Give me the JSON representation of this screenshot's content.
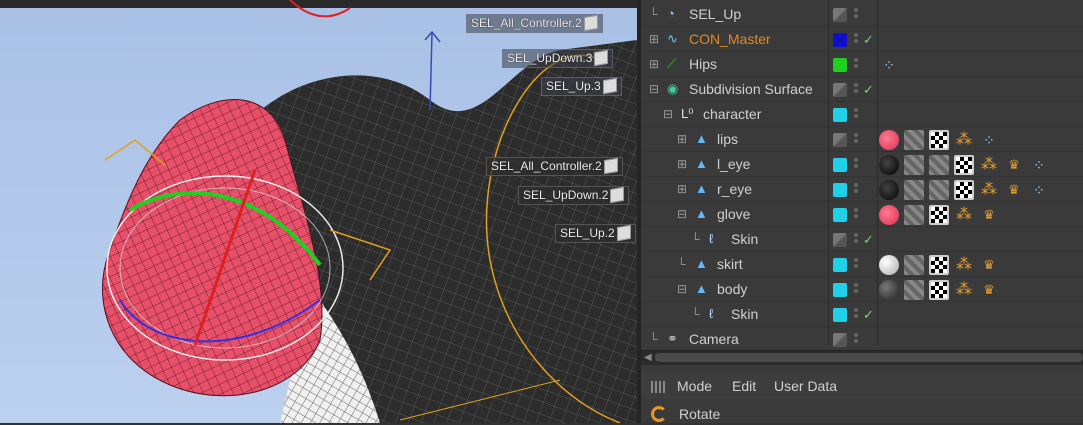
{
  "viewport": {
    "labels": [
      {
        "text": "SEL_All_Controller.2",
        "style": "light",
        "icon": "cube-icon"
      },
      {
        "text": "SEL_UpDown.3",
        "style": "light",
        "icon": "cube-icon"
      },
      {
        "text": "SEL_Up.3",
        "style": "light",
        "icon": "cube-icon"
      },
      {
        "text": "SEL_All_Controller.2",
        "style": "dark",
        "icon": "cube-icon"
      },
      {
        "text": "SEL_UpDown.2",
        "style": "dark",
        "icon": "cube-icon"
      },
      {
        "text": "SEL_Up.2",
        "style": "dark",
        "icon": "cube-icon"
      }
    ]
  },
  "object_manager": {
    "rows": [
      {
        "name": "SEL_Up",
        "icon": "selection-object-icon",
        "layer_color": "grey",
        "checked": false,
        "tags": []
      },
      {
        "name": "CON_Master",
        "icon": "spline-icon",
        "layer_color": "#1010c8",
        "checked": true,
        "name_color": "#e08a20",
        "tags": []
      },
      {
        "name": "Hips",
        "icon": "bone-icon",
        "layer_color": "#20d020",
        "checked": false,
        "tags": [
          "selection-tag-icon"
        ]
      },
      {
        "name": "Subdivision Surface",
        "icon": "subdivision-surface-icon",
        "layer_color": "grey",
        "checked": true,
        "tags": []
      },
      {
        "name": "character",
        "icon": "null-object-icon",
        "layer_color": "#20d0e8",
        "checked": false,
        "tags": []
      },
      {
        "name": "lips",
        "icon": "polygon-object-icon",
        "layer_color": "grey",
        "checked": false,
        "tags": [
          "material-red-icon",
          "texture-tag-icon",
          "checker-tag-icon",
          "uvw-tag-icon",
          "selection-tag-icon"
        ]
      },
      {
        "name": "l_eye",
        "icon": "polygon-object-icon",
        "layer_color": "#20d0e8",
        "checked": false,
        "tags": [
          "material-black-icon",
          "texture-tag-icon",
          "texture-tag-icon",
          "checker-tag-icon",
          "uvw-tag-icon",
          "weight-tag-icon",
          "selection-tag-icon"
        ]
      },
      {
        "name": "r_eye",
        "icon": "polygon-object-icon",
        "layer_color": "#20d0e8",
        "checked": false,
        "tags": [
          "material-black-icon",
          "texture-tag-icon",
          "texture-tag-icon",
          "checker-tag-icon",
          "uvw-tag-icon",
          "weight-tag-icon",
          "selection-tag-icon"
        ]
      },
      {
        "name": "glove",
        "icon": "polygon-object-icon",
        "layer_color": "#20d0e8",
        "checked": false,
        "tags": [
          "material-red-icon",
          "texture-tag-icon",
          "checker-tag-icon",
          "uvw-tag-icon",
          "weight-tag-icon"
        ]
      },
      {
        "name": "Skin",
        "icon": "skin-deformer-icon",
        "layer_color": "grey",
        "checked": true,
        "tags": []
      },
      {
        "name": "skirt",
        "icon": "polygon-object-icon",
        "layer_color": "#20d0e8",
        "checked": false,
        "tags": [
          "material-white-icon",
          "texture-tag-icon",
          "checker-tag-icon",
          "uvw-tag-icon",
          "weight-tag-icon"
        ]
      },
      {
        "name": "body",
        "icon": "polygon-object-icon",
        "layer_color": "#20d0e8",
        "checked": false,
        "tags": [
          "material-dark-icon",
          "texture-tag-icon",
          "checker-tag-icon",
          "uvw-tag-icon",
          "weight-tag-icon"
        ]
      },
      {
        "name": "Skin",
        "icon": "skin-deformer-icon",
        "layer_color": "#20d0e8",
        "checked": true,
        "tags": []
      },
      {
        "name": "Camera",
        "icon": "camera-icon",
        "layer_color": "grey",
        "checked": false,
        "tags": []
      }
    ]
  },
  "attribute_manager": {
    "menu": [
      "Mode",
      "Edit",
      "User Data"
    ],
    "tool": "Rotate"
  }
}
